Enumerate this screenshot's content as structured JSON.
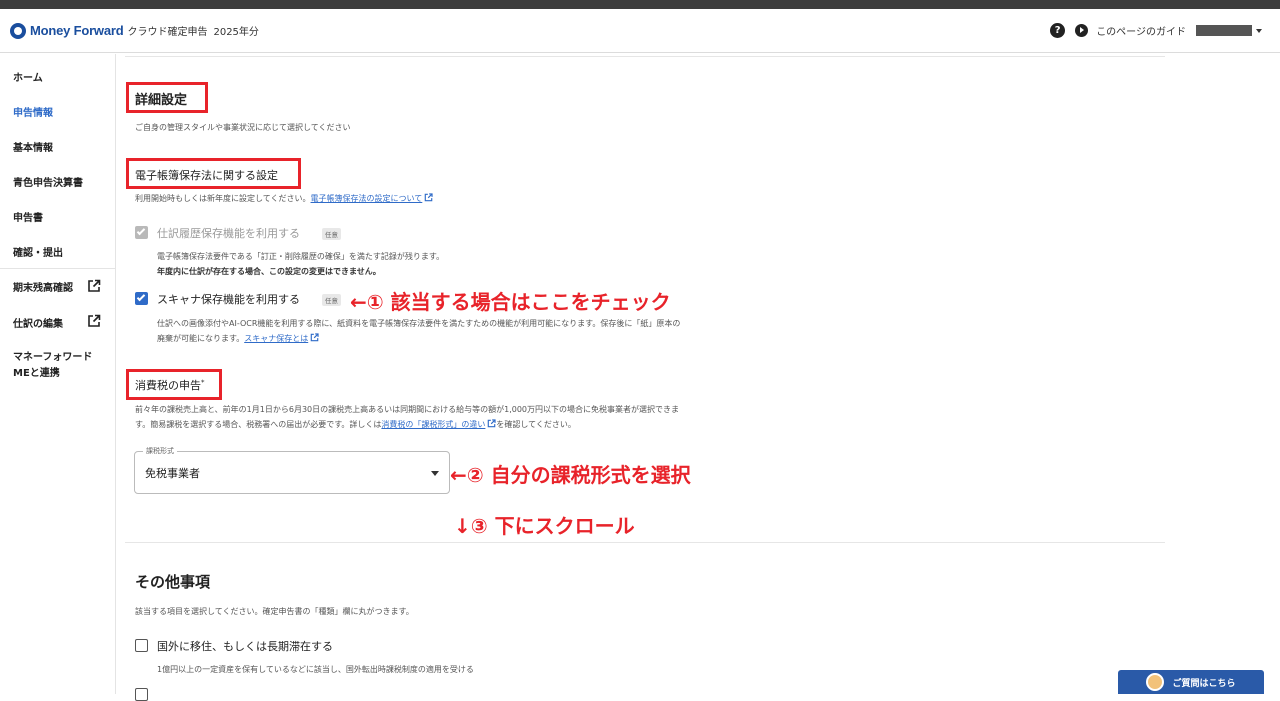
{
  "header": {
    "logo_text": "Money Forward",
    "app_name": "クラウド確定申告",
    "app_year": "2025年分",
    "guide_label": "このページのガイド"
  },
  "sidebar": {
    "items": [
      {
        "label": "ホーム"
      },
      {
        "label": "申告情報",
        "active": true
      },
      {
        "label": "基本情報"
      },
      {
        "label": "青色申告決算書"
      },
      {
        "label": "申告書"
      },
      {
        "label": "確認・提出"
      },
      {
        "label": "期末残高確認",
        "external": true
      },
      {
        "label": "仕訳の編集",
        "external": true
      },
      {
        "label": "マネーフォワード",
        "label2": "MEと連携"
      }
    ]
  },
  "main": {
    "detail": {
      "title": "詳細設定",
      "desc": "ご自身の管理スタイルや事業状況に応じて選択してください"
    },
    "ebook": {
      "title": "電子帳簿保存法に関する設定",
      "desc_prefix": "利用開始時もしくは新年度に設定してください。",
      "desc_link": "電子帳簿保存法の設定について",
      "history": {
        "label": "仕訳履歴保存機能を利用する",
        "badge": "任意",
        "desc1": "電子帳簿保存法要件である「訂正・削除履歴の確保」を満たす記録が残ります。",
        "desc2": "年度内に仕訳が存在する場合、この設定の変更はできません。"
      },
      "scanner": {
        "label": "スキャナ保存機能を利用する",
        "badge": "任意",
        "desc1": "仕訳への画像添付やAI-OCR機能を利用する際に、紙資料を電子帳簿保存法要件を満たすための機能が利用可能になります。保存後に「紙」原本の",
        "desc2_prefix": "廃棄が可能になります。",
        "desc2_link": "スキャナ保存とは"
      }
    },
    "tax": {
      "title": "消費税の申告",
      "required_mark": "*",
      "desc1": "前々年の課税売上高と、前年の1月1日から6月30日の課税売上高あるいは同期間における給与等の額が1,000万円以下の場合に免税事業者が選択できま",
      "desc2_prefix": "す。簡易課税を選択する場合、税務署への届出が必要です。詳しくは",
      "desc2_link": "消費税の「課税形式」の違い",
      "desc2_suffix": "を確認してください。",
      "select_label": "課税形式",
      "select_value": "免税事業者"
    },
    "other": {
      "title": "その他事項",
      "desc": "該当する項目を選択してください。確定申告書の「種類」欄に丸がつきます。",
      "item1_label": "国外に移住、もしくは長期滞在する",
      "item1_desc": "1億円以上の一定資産を保有しているなどに該当し、国外転出時課税制度の適用を受ける"
    }
  },
  "annotations": {
    "a1": "←① 該当する場合はここをチェック",
    "a2": "←② 自分の課税形式を選択",
    "a3": "↓③ 下にスクロール"
  },
  "chat": {
    "label": "ご質問はこちら"
  },
  "colors": {
    "accent": "#2f6bc8",
    "highlight_red": "#e8232a",
    "brand_blue": "#1a4e9e"
  }
}
